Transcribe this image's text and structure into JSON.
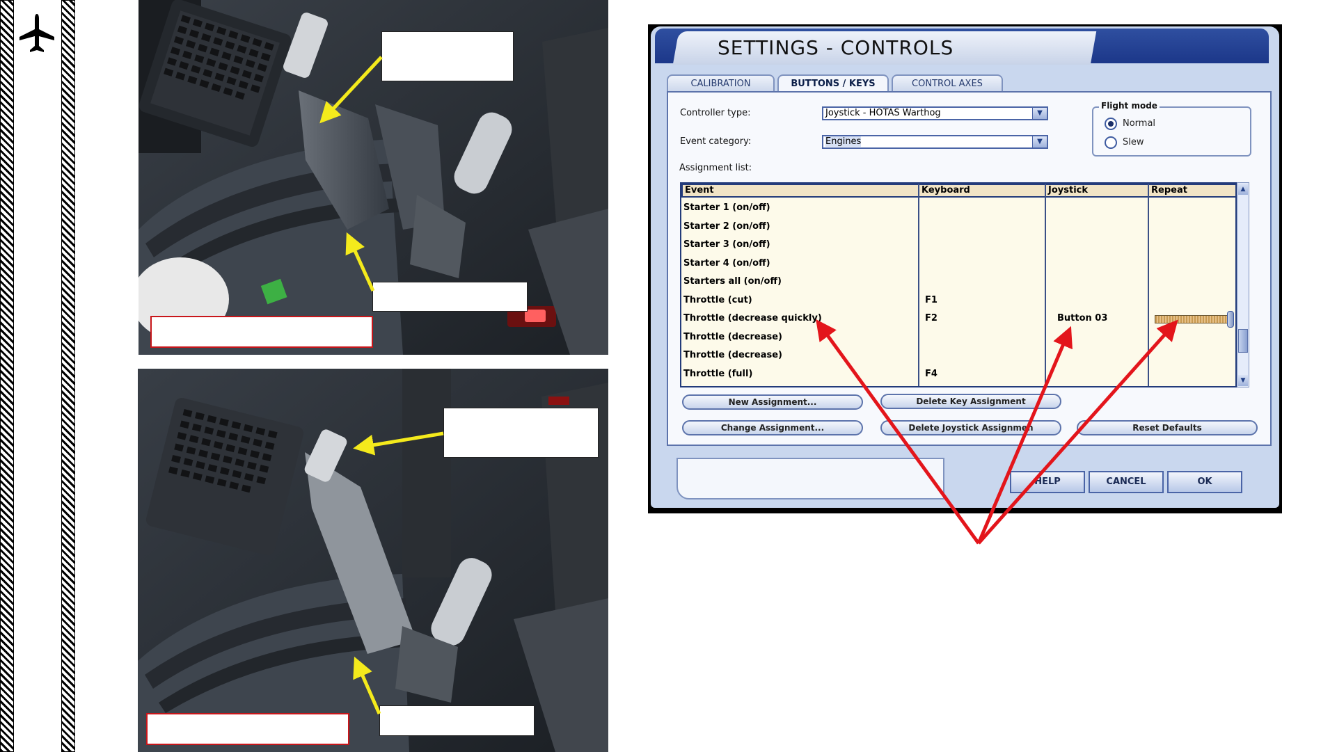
{
  "dialog": {
    "title": "SETTINGS - CONTROLS",
    "tabs": [
      {
        "label": "CALIBRATION"
      },
      {
        "label": "BUTTONS / KEYS"
      },
      {
        "label": "CONTROL AXES"
      }
    ],
    "controller_type_label": "Controller type:",
    "controller_type_value": "Joystick - HOTAS Warthog",
    "event_category_label": "Event category:",
    "event_category_value": "Engines",
    "flight_mode": {
      "legend": "Flight mode",
      "options": [
        {
          "label": "Normal",
          "selected": true
        },
        {
          "label": "Slew",
          "selected": false
        }
      ]
    },
    "assignment_list_label": "Assignment list:",
    "table": {
      "headers": [
        "Event",
        "Keyboard",
        "Joystick",
        "Repeat"
      ],
      "rows": [
        {
          "event": "Starter 1 (on/off)",
          "keyboard": "",
          "joystick": ""
        },
        {
          "event": "Starter 2 (on/off)",
          "keyboard": "",
          "joystick": ""
        },
        {
          "event": "Starter 3 (on/off)",
          "keyboard": "",
          "joystick": ""
        },
        {
          "event": "Starter 4 (on/off)",
          "keyboard": "",
          "joystick": ""
        },
        {
          "event": "Starters all (on/off)",
          "keyboard": "",
          "joystick": ""
        },
        {
          "event": "Throttle (cut)",
          "keyboard": "F1",
          "joystick": ""
        },
        {
          "event": "Throttle (decrease quickly)",
          "keyboard": "F2",
          "joystick": "Button 03"
        },
        {
          "event": "Throttle (decrease)",
          "keyboard": "",
          "joystick": ""
        },
        {
          "event": "Throttle (decrease)",
          "keyboard": "",
          "joystick": ""
        },
        {
          "event": "Throttle (full)",
          "keyboard": "F4",
          "joystick": ""
        }
      ],
      "repeat_level": 1.0
    },
    "buttons": {
      "new_assignment": "New Assignment...",
      "delete_key_assignment": "Delete Key Assignment",
      "change_assignment": "Change Assignment...",
      "delete_joystick_assignment": "Delete Joystick Assignmen",
      "reset_defaults": "Reset Defaults",
      "help": "HELP",
      "cancel": "CANCEL",
      "ok": "OK"
    }
  },
  "icons": {
    "sidebar": "airplane-icon",
    "combo_arrow": "chevron-down-icon",
    "scroll_up": "arrow-up-icon",
    "scroll_down": "arrow-down-icon"
  },
  "colors": {
    "arrow_yellow": "#f4ea1c",
    "arrow_red": "#e3151b",
    "label_border_red": "#c8161a",
    "dialog_title_blue": "#1c3789",
    "table_background": "#fdfaea"
  }
}
